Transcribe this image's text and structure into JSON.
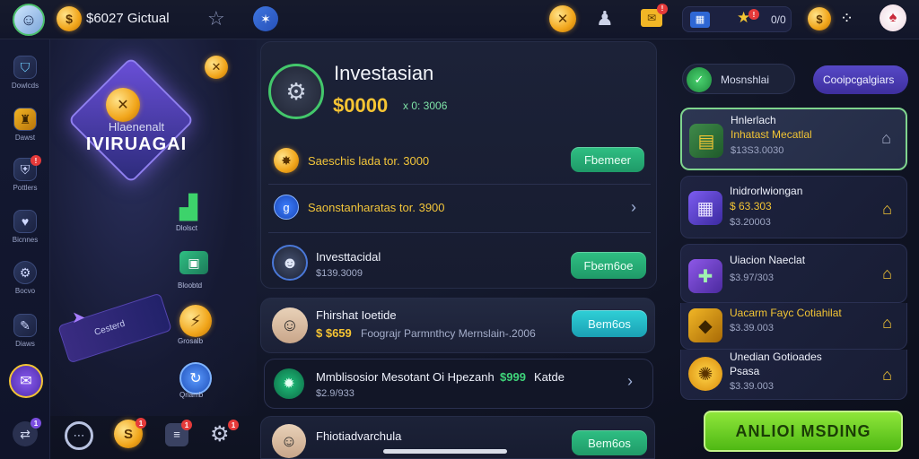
{
  "topbar": {
    "balance": "$6027 Gictual",
    "counter": "0/0"
  },
  "sidebar": {
    "items": [
      {
        "label": "Dowlcds"
      },
      {
        "label": "Dawst"
      },
      {
        "label": "Pottlers"
      },
      {
        "label": "Bicnnes"
      },
      {
        "label": "Bocvo"
      },
      {
        "label": "Diaws"
      }
    ]
  },
  "promo": {
    "title_line1": "Hlaenenalt",
    "title_line2": "IVIRUAGAI",
    "chart_label": "Dlolsct",
    "wallet_label": "Bloobtd",
    "coin_label": "Grosalb",
    "blue_label": "Qriamb",
    "banner_text": "Cesterd"
  },
  "header": {
    "title": "Investasian",
    "amount": "$0000",
    "subamount": "x 0: 3006"
  },
  "rows": {
    "row1": {
      "text": "Saeschis lada tor. 3000",
      "button": "Fbemeer"
    },
    "row2": {
      "text": "Saonstanharatas tor. 3900"
    },
    "row3": {
      "title": "Investtacidal",
      "sub": "$139.3009",
      "button": "Fbem6oe"
    },
    "row4": {
      "title": "Fhirshat Ioetide",
      "price": "$ $659",
      "desc": "Foograjr Parmnthcy Mernslain-.2006",
      "button": "Bem6os"
    },
    "row5": {
      "title": "Mmblisosior Mesotant Oi Hpezanh",
      "price": "$999",
      "tail": "Katde",
      "sub": "$2.9/933"
    },
    "row6": {
      "title": "Fhiotiadvarchula",
      "button": "Bem6os"
    }
  },
  "right": {
    "tab1": "Mosnshlai",
    "tab2": "Cooipcgalgiars",
    "cards": [
      {
        "title_line1": "Hnlerlach",
        "title_line2": "Inhatast Mecatlal",
        "sub": "$13S3.0030"
      },
      {
        "title_line1": "Inidrorlwiongan",
        "price": "$ 63.303",
        "sub": "$3.20003"
      },
      {
        "title_line1": "Uiacion Naeclat",
        "sub": "$3.97/303"
      },
      {
        "title_line1": "Uacarm Fayc Cotiahilat",
        "sub": "$3.39.003"
      },
      {
        "title_line1": "Unedian Gotioades",
        "title_line2": "Psasa",
        "sub": "$3.39.003"
      }
    ],
    "cta": "ANLIOI MSDING"
  },
  "bottom": {
    "badge1": "1",
    "badge2": "1",
    "badge3": "1",
    "badge4": "1"
  },
  "colors": {
    "accent_green": "#2fbf83",
    "accent_teal": "#2fd0d7",
    "gold": "#f6c433",
    "cta_green": "#6bd31e",
    "purple_tab": "#4b3fb0"
  }
}
